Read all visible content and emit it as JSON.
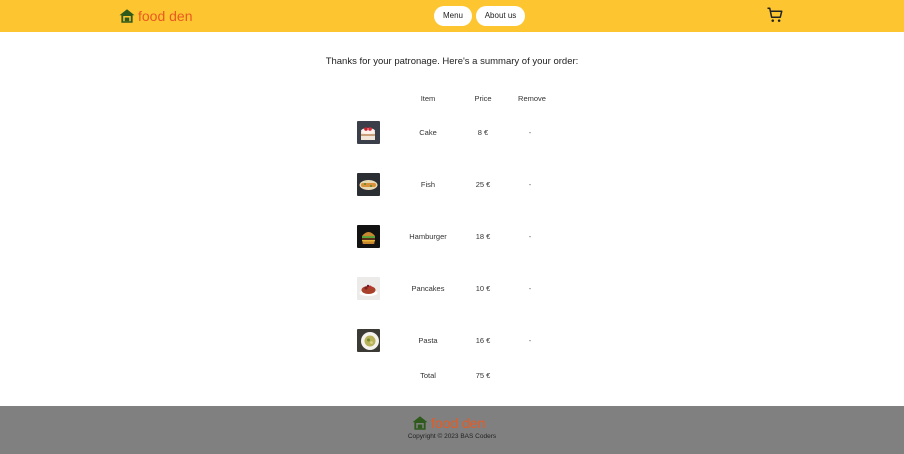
{
  "header": {
    "brand": "food den",
    "nav": {
      "menu": "Menu",
      "about": "About us"
    }
  },
  "main": {
    "intro": "Thanks for your patronage. Here's a summary of your order:",
    "columns": {
      "item": "Item",
      "price": "Price",
      "remove": "Remove"
    },
    "items": [
      {
        "name": "Cake",
        "price": "8 €",
        "remove": "-"
      },
      {
        "name": "Fish",
        "price": "25 €",
        "remove": "-"
      },
      {
        "name": "Hamburger",
        "price": "18 €",
        "remove": "-"
      },
      {
        "name": "Pancakes",
        "price": "10 €",
        "remove": "-"
      },
      {
        "name": "Pasta",
        "price": "16 €",
        "remove": "-"
      }
    ],
    "total_label": "Total",
    "total_value": "75 €"
  },
  "footer": {
    "brand": "food den",
    "copyright": "Copyright © 2023 BAS Coders"
  },
  "colors": {
    "header_bg": "#fdc530",
    "footer_bg": "#808080",
    "brand_text": "#e85a21",
    "logo_icon": "#2e5a1c"
  }
}
